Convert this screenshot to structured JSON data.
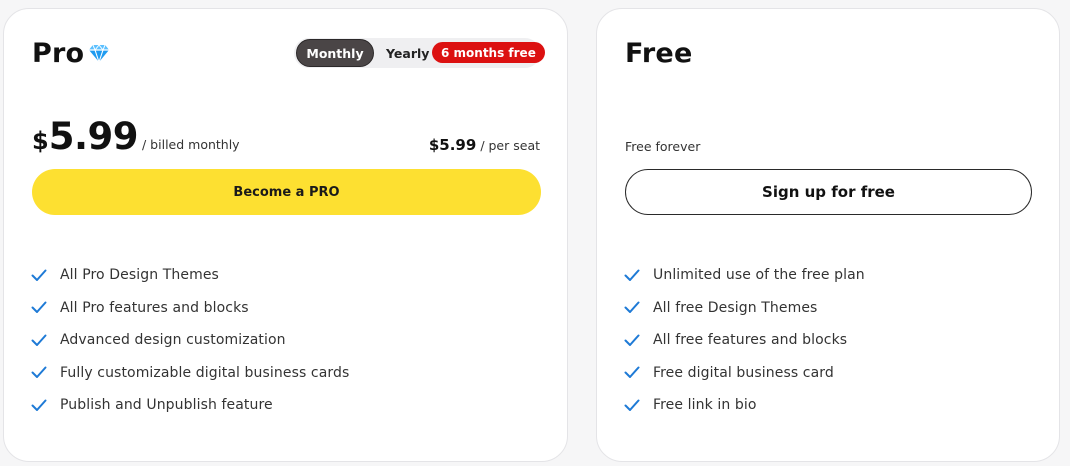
{
  "pro": {
    "title": "Pro",
    "icon": "diamond-icon",
    "toggle": {
      "monthly_label": "Monthly",
      "yearly_label": "Yearly",
      "badge": "6 months free",
      "selected": "Monthly"
    },
    "currency": "$",
    "price": "5.99",
    "billing": "/ billed monthly",
    "per_seat_price": "$5.99",
    "per_seat_label": "/ per seat",
    "cta": "Become a PRO",
    "features": [
      "All Pro Design Themes",
      "All Pro features and blocks",
      "Advanced design customization",
      "Fully customizable digital business cards",
      "Publish and Unpublish feature"
    ]
  },
  "free": {
    "title": "Free",
    "subtitle": "Free forever",
    "cta": "Sign up for free",
    "features": [
      "Unlimited use of the free plan",
      "All free Design Themes",
      "All free features and blocks",
      "Free digital business card",
      "Free link in bio"
    ]
  },
  "colors": {
    "cta_yellow": "#fde031",
    "badge_red": "#dc1111",
    "toggle_active": "#4a4546",
    "check_blue": "#1e7ad6",
    "diamond_blue": "#1e9bf0"
  }
}
